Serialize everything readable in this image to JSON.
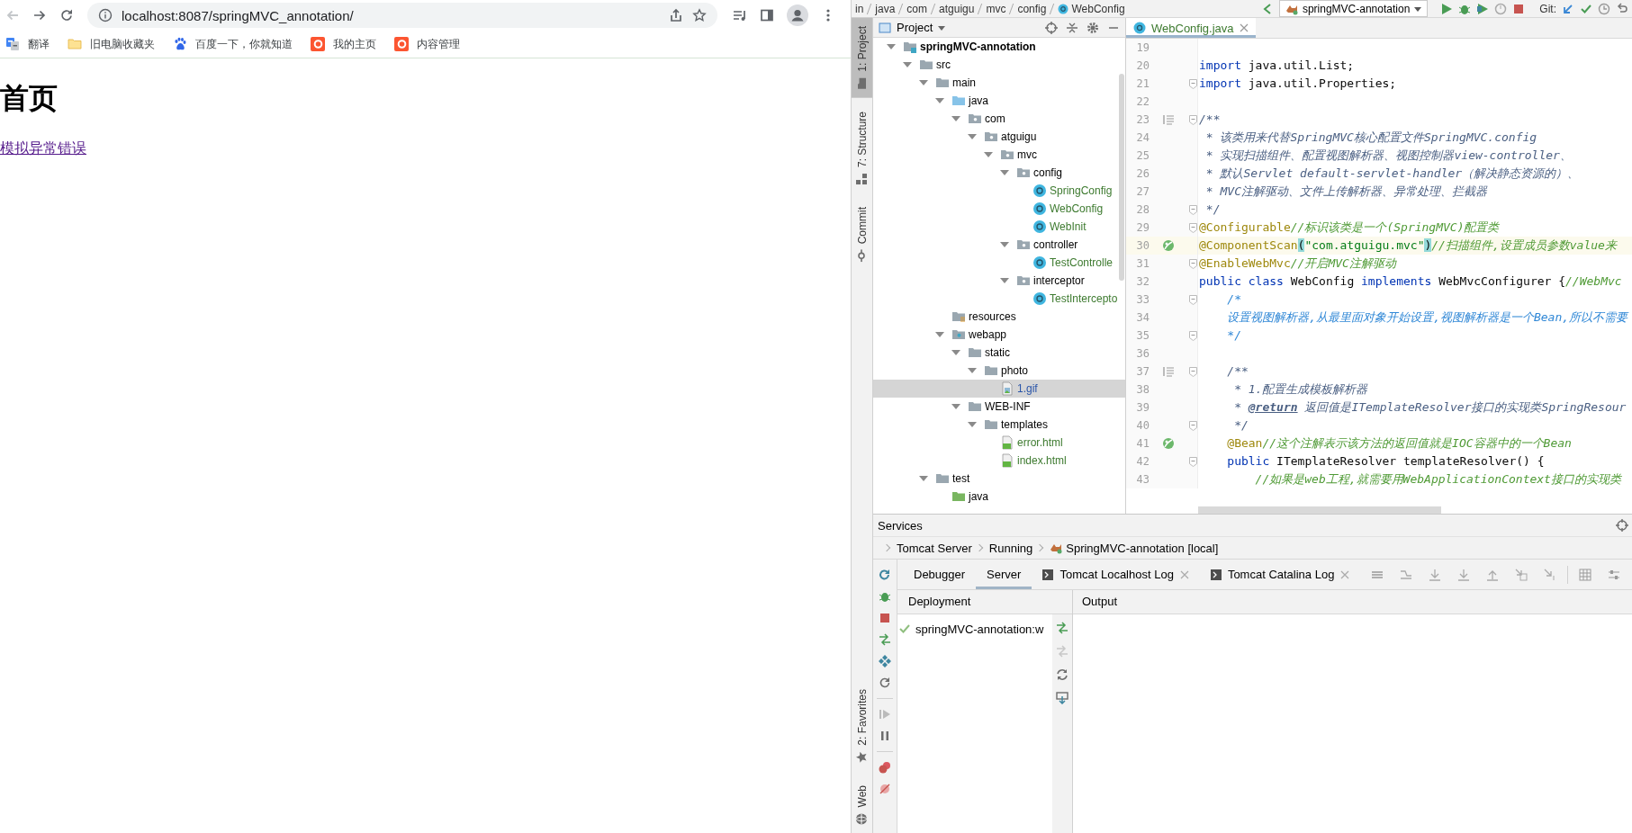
{
  "browser": {
    "can_go_back": false,
    "address": "localhost:8087/springMVC_annotation/",
    "bookmarks": [
      {
        "label": "翻译",
        "kind": "translate"
      },
      {
        "label": "旧电脑收藏夹",
        "kind": "folder"
      },
      {
        "label": "百度一下，你就知道",
        "kind": "paw"
      },
      {
        "label": "我的主页",
        "kind": "brand"
      },
      {
        "label": "内容管理",
        "kind": "brand"
      }
    ],
    "page": {
      "heading": "首页",
      "link": "模拟异常错误"
    }
  },
  "ide": {
    "breadcrumb": [
      "in",
      "java",
      "com",
      "atguigu",
      "mvc",
      "config",
      "WebConfig"
    ],
    "run_config": "springMVC-annotation",
    "vcs_label": "Git:",
    "stripe_top": [
      {
        "label": "1: Project",
        "kind": "project",
        "selected": true
      },
      {
        "label": "7: Structure",
        "kind": "structure",
        "selected": false
      },
      {
        "label": "Commit",
        "kind": "commit",
        "selected": false
      }
    ],
    "stripe_bottom": [
      {
        "label": "2: Favorites",
        "kind": "favorites",
        "selected": false
      },
      {
        "label": "Web",
        "kind": "web",
        "selected": false
      }
    ],
    "project": {
      "title": "Project",
      "tree": [
        {
          "label": "springMVC-annotation",
          "kind": "module",
          "expanded": true,
          "selected": false,
          "children": [
            {
              "label": "src",
              "kind": "folder",
              "expanded": true,
              "selected": false,
              "children": [
                {
                  "label": "main",
                  "kind": "folder",
                  "expanded": true,
                  "selected": false,
                  "children": [
                    {
                      "label": "java",
                      "kind": "source",
                      "expanded": true,
                      "selected": false,
                      "children": [
                        {
                          "label": "com",
                          "kind": "package",
                          "expanded": true,
                          "selected": false,
                          "children": [
                            {
                              "label": "atguigu",
                              "kind": "package",
                              "expanded": true,
                              "selected": false,
                              "children": [
                                {
                                  "label": "mvc",
                                  "kind": "package",
                                  "expanded": true,
                                  "selected": false,
                                  "children": [
                                    {
                                      "label": "config",
                                      "kind": "package",
                                      "expanded": true,
                                      "selected": false,
                                      "children": [
                                        {
                                          "label": "SpringConfig",
                                          "kind": "class",
                                          "color": "#3d7a2f",
                                          "selected": false
                                        },
                                        {
                                          "label": "WebConfig",
                                          "kind": "class",
                                          "color": "#3d7a2f",
                                          "selected": false
                                        },
                                        {
                                          "label": "WebInit",
                                          "kind": "class",
                                          "color": "#3d7a2f",
                                          "selected": false
                                        }
                                      ]
                                    },
                                    {
                                      "label": "controller",
                                      "kind": "package",
                                      "expanded": true,
                                      "selected": false,
                                      "children": [
                                        {
                                          "label": "TestControlle",
                                          "kind": "class",
                                          "color": "#3d7a2f",
                                          "selected": false
                                        }
                                      ]
                                    },
                                    {
                                      "label": "interceptor",
                                      "kind": "package",
                                      "expanded": true,
                                      "selected": false,
                                      "children": [
                                        {
                                          "label": "TestIntercepto",
                                          "kind": "class",
                                          "color": "#3d7a2f",
                                          "selected": false
                                        }
                                      ]
                                    }
                                  ]
                                }
                              ]
                            }
                          ]
                        }
                      ]
                    },
                    {
                      "label": "resources",
                      "kind": "resources",
                      "selected": false
                    },
                    {
                      "label": "webapp",
                      "kind": "web",
                      "expanded": true,
                      "selected": false,
                      "children": [
                        {
                          "label": "static",
                          "kind": "folder",
                          "expanded": true,
                          "selected": false,
                          "children": [
                            {
                              "label": "photo",
                              "kind": "folder",
                              "expanded": true,
                              "selected": false,
                              "children": [
                                {
                                  "label": "1.gif",
                                  "kind": "image",
                                  "color": "#2a55a8",
                                  "selected": true
                                }
                              ]
                            }
                          ]
                        },
                        {
                          "label": "WEB-INF",
                          "kind": "folder",
                          "expanded": true,
                          "selected": false,
                          "children": [
                            {
                              "label": "templates",
                              "kind": "folder",
                              "expanded": true,
                              "selected": false,
                              "children": [
                                {
                                  "label": "error.html",
                                  "kind": "html",
                                  "color": "#3d7a2f",
                                  "selected": false
                                },
                                {
                                  "label": "index.html",
                                  "kind": "html",
                                  "color": "#3d7a2f",
                                  "selected": false
                                }
                              ]
                            }
                          ]
                        }
                      ]
                    }
                  ]
                },
                {
                  "label": "test",
                  "kind": "folder",
                  "expanded": true,
                  "selected": false,
                  "children": [
                    {
                      "label": "java",
                      "kind": "test",
                      "selected": false
                    }
                  ]
                }
              ]
            }
          ]
        }
      ]
    },
    "editor": {
      "tabs": [
        {
          "label": "WebConfig.java",
          "selected": true
        }
      ],
      "lines": [
        {
          "n": "19"
        },
        {
          "n": "20",
          "segments": [
            {
              "kind": "keyword",
              "t": "import"
            },
            {
              "kind": "plain",
              "t": " java.util.List;"
            }
          ]
        },
        {
          "n": "21",
          "fold": true,
          "segments": [
            {
              "kind": "keyword",
              "t": "import"
            },
            {
              "kind": "plain",
              "t": " java.util.Properties;"
            }
          ]
        },
        {
          "n": "22"
        },
        {
          "n": "23",
          "kind": "doc",
          "fold": true,
          "segments": [
            {
              "kind": "doc",
              "t": "/**"
            }
          ]
        },
        {
          "n": "24",
          "segments": [
            {
              "kind": "doc",
              "t": " * 该类用来代替SpringMVC核心配置文件SpringMVC.config"
            }
          ]
        },
        {
          "n": "25",
          "segments": [
            {
              "kind": "doc",
              "t": " * 实现扫描组件、配置视图解析器、视图控制器view-controller、"
            }
          ]
        },
        {
          "n": "26",
          "segments": [
            {
              "kind": "doc",
              "t": " * 默认Servlet default-servlet-handler（解决静态资源的）、"
            }
          ]
        },
        {
          "n": "27",
          "segments": [
            {
              "kind": "doc",
              "t": " * MVC注解驱动、文件上传解析器、异常处理、拦截器"
            }
          ]
        },
        {
          "n": "28",
          "fold": true,
          "segments": [
            {
              "kind": "doc",
              "t": " */"
            }
          ]
        },
        {
          "n": "29",
          "fold": true,
          "segments": [
            {
              "kind": "annotation",
              "t": "@Configurable"
            },
            {
              "kind": "line",
              "t": "//标识该类是一个(SpringMVC)配置类"
            }
          ]
        },
        {
          "n": "30",
          "kind": "bean",
          "current": true,
          "segments": [
            {
              "kind": "annotation",
              "t": "@ComponentScan"
            },
            {
              "kind": "bracket",
              "t": "("
            },
            {
              "kind": "string",
              "t": "\"com.atguigu.mvc\""
            },
            {
              "kind": "bracket",
              "t": ")"
            },
            {
              "kind": "line",
              "t": "//扫描组件,设置成员参数value来"
            }
          ]
        },
        {
          "n": "31",
          "fold": true,
          "segments": [
            {
              "kind": "annotation",
              "t": "@EnableWebMvc"
            },
            {
              "kind": "line",
              "t": "//开启MVC注解驱动"
            }
          ]
        },
        {
          "n": "32",
          "segments": [
            {
              "kind": "keyword",
              "t": "public"
            },
            {
              "kind": "keyword",
              "t": " class"
            },
            {
              "kind": "plain",
              "t": " WebConfig "
            },
            {
              "kind": "keyword",
              "t": "implements"
            },
            {
              "kind": "plain",
              "t": " WebMvcConfigurer {"
            },
            {
              "kind": "line",
              "t": "//WebMvc"
            }
          ]
        },
        {
          "n": "33",
          "fold": true,
          "segments": [
            {
              "kind": "block",
              "t": "    /*"
            }
          ]
        },
        {
          "n": "34",
          "segments": [
            {
              "kind": "block",
              "t": "    设置视图解析器,从最里面对象开始设置,视图解析器是一个Bean,所以不需要"
            }
          ]
        },
        {
          "n": "35",
          "fold": true,
          "segments": [
            {
              "kind": "block",
              "t": "    */"
            }
          ]
        },
        {
          "n": "36"
        },
        {
          "n": "37",
          "kind": "doc",
          "fold": true,
          "segments": [
            {
              "kind": "doc",
              "t": "    /**"
            }
          ]
        },
        {
          "n": "38",
          "segments": [
            {
              "kind": "doc",
              "t": "     * 1.配置生成模板解析器"
            }
          ]
        },
        {
          "n": "39",
          "segments": [
            {
              "kind": "doc",
              "t": "     * "
            },
            {
              "kind": "doctag",
              "t": "@return"
            },
            {
              "kind": "doc",
              "t": " 返回值是ITemplateResolver接口的实现类SpringResour"
            }
          ]
        },
        {
          "n": "40",
          "fold": true,
          "segments": [
            {
              "kind": "doc",
              "t": "     */"
            }
          ]
        },
        {
          "n": "41",
          "kind": "bean",
          "segments": [
            {
              "kind": "annotation",
              "t": "    @Bean"
            },
            {
              "kind": "line",
              "t": "//这个注解表示该方法的返回值就是IOC容器中的一个Bean"
            }
          ]
        },
        {
          "n": "42",
          "fold": true,
          "segments": [
            {
              "kind": "keyword",
              "t": "    public"
            },
            {
              "kind": "plain",
              "t": " ITemplateResolver templateResolver() {"
            }
          ]
        },
        {
          "n": "43",
          "segments": [
            {
              "kind": "line",
              "t": "        //如果是web工程,就需要用WebApplicationContext接口的实现类"
            }
          ]
        }
      ]
    },
    "services": {
      "title": "Services",
      "path": [
        "Tomcat Server",
        "Running",
        "SpringMVC-annotation [local]"
      ],
      "tabs": [
        {
          "label": "Debugger",
          "kind": "plain",
          "selected": false
        },
        {
          "label": "Server",
          "kind": "plain",
          "selected": true
        },
        {
          "label": "Tomcat Localhost Log",
          "kind": "log",
          "selected": false
        },
        {
          "label": "Tomcat Catalina Log",
          "kind": "log",
          "selected": false
        }
      ],
      "deployment_header": "Deployment",
      "output_header": "Output",
      "deployments": [
        {
          "label": "springMVC-annotation:w",
          "deployed": true
        }
      ]
    }
  }
}
